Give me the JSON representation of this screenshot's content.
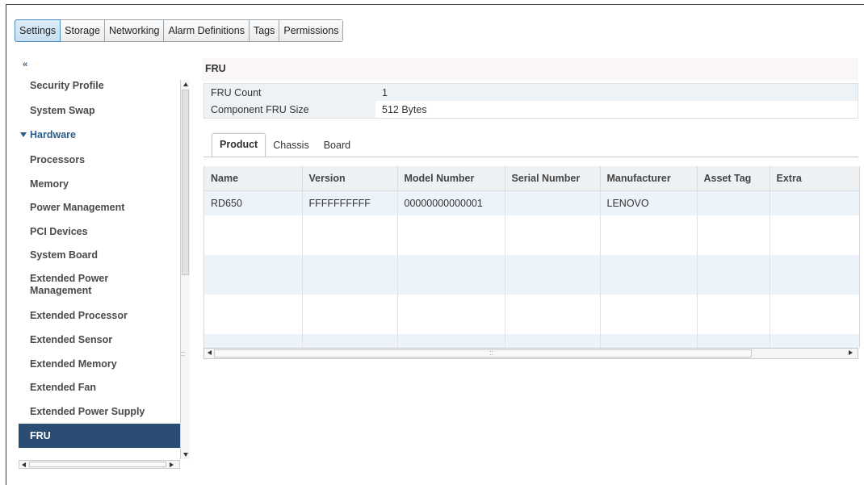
{
  "top_tabs": [
    "Settings",
    "Storage",
    "Networking",
    "Alarm Definitions",
    "Tags",
    "Permissions"
  ],
  "sidebar": {
    "collapse_icon": "«",
    "items": [
      {
        "label": "Security Profile"
      },
      {
        "label": "System Swap"
      },
      {
        "label": "Hardware"
      },
      {
        "label": "Processors"
      },
      {
        "label": "Memory"
      },
      {
        "label": "Power Management"
      },
      {
        "label": "PCI Devices"
      },
      {
        "label": "System Board"
      },
      {
        "label": "Extended Power Management"
      },
      {
        "label": "Extended Processor"
      },
      {
        "label": "Extended Sensor"
      },
      {
        "label": "Extended Memory"
      },
      {
        "label": "Extended Fan"
      },
      {
        "label": "Extended Power Supply"
      },
      {
        "label": "FRU"
      }
    ]
  },
  "main": {
    "title": "FRU",
    "info": [
      {
        "label": "FRU Count",
        "value": "1"
      },
      {
        "label": "Component FRU Size",
        "value": "512 Bytes"
      }
    ],
    "subtabs": [
      "Product",
      "Chassis",
      "Board"
    ],
    "grid": {
      "columns": [
        "Name",
        "Version",
        "Model Number",
        "Serial Number",
        "Manufacturer",
        "Asset Tag",
        "Extra"
      ],
      "rows": [
        [
          "RD650",
          "FFFFFFFFFF",
          "00000000000001",
          "",
          "LENOVO",
          "",
          ""
        ]
      ]
    }
  },
  "colors": {
    "accent": "#2b5d8a",
    "selected_bg": "#2b4d73",
    "row_alt": "#edf3fa"
  }
}
